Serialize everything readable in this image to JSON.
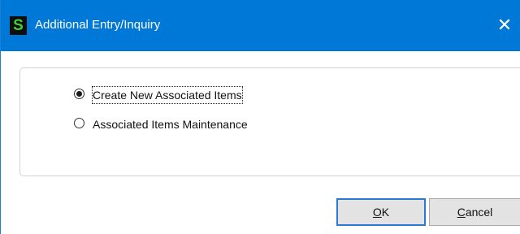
{
  "window": {
    "app_icon_letter": "S",
    "title": "Additional Entry/Inquiry",
    "close_glyph": "✕"
  },
  "options": [
    {
      "label": "Create New Associated Items",
      "selected": true
    },
    {
      "label": "Associated Items Maintenance",
      "selected": false
    }
  ],
  "buttons": {
    "ok": {
      "mnemonic": "O",
      "rest": "K"
    },
    "cancel": {
      "mnemonic": "C",
      "rest": "ancel"
    }
  },
  "colors": {
    "titlebar": "#0078d7",
    "app_icon_fg": "#3fd13a",
    "app_icon_bg": "#0e0e0e"
  }
}
